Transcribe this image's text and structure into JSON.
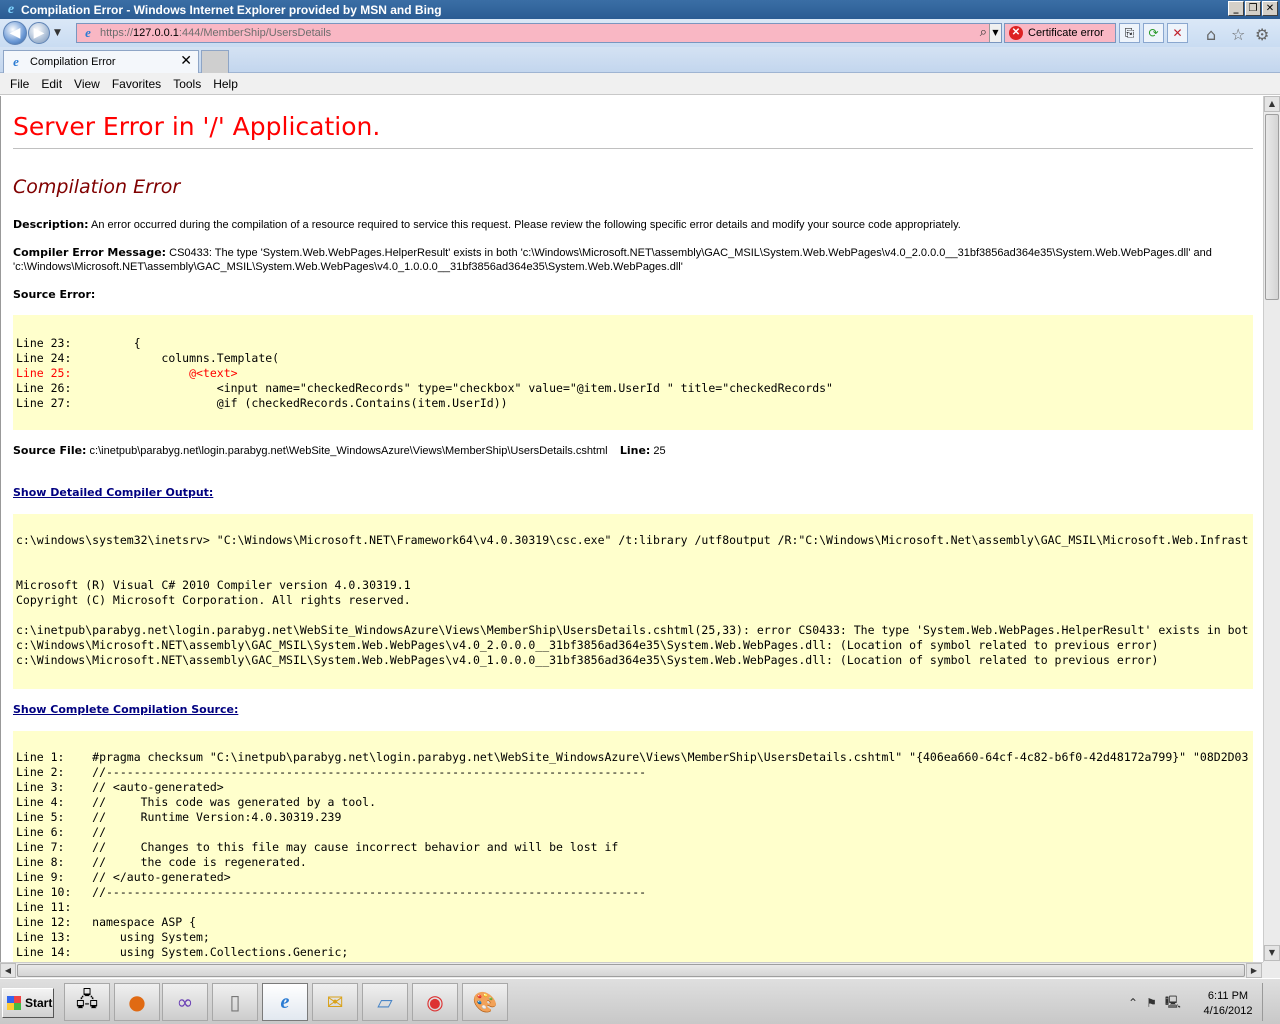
{
  "window": {
    "title": "Compilation Error - Windows Internet Explorer provided by MSN and Bing",
    "minimize": "_",
    "restore": "❐",
    "close": "✕"
  },
  "addressbar": {
    "url_scheme": "https://",
    "url_host": "127.0.0.1",
    "url_rest": ":444/MemberShip/UsersDetails",
    "certificate_label": "Certificate error"
  },
  "tabs": [
    {
      "label": "Compilation Error"
    }
  ],
  "menu": [
    "File",
    "Edit",
    "View",
    "Favorites",
    "Tools",
    "Help"
  ],
  "page": {
    "heading": "Server Error in '/' Application.",
    "subheading": "Compilation Error",
    "description_label": "Description:",
    "description_text": "An error occurred during the compilation of a resource required to service this request. Please review the following specific error details and modify your source code appropriately.",
    "compiler_msg_label": "Compiler Error Message:",
    "compiler_msg_line1": "CS0433: The type 'System.Web.WebPages.HelperResult' exists in both 'c:\\Windows\\Microsoft.NET\\assembly\\GAC_MSIL\\System.Web.WebPages\\v4.0_2.0.0.0__31bf3856ad364e35\\System.Web.WebPages.dll' and",
    "compiler_msg_line2": "'c:\\Windows\\Microsoft.NET\\assembly\\GAC_MSIL\\System.Web.WebPages\\v4.0_1.0.0.0__31bf3856ad364e35\\System.Web.WebPages.dll'",
    "source_error_label": "Source Error:",
    "source_error_lines": [
      {
        "text": "Line 23:         {",
        "highlight": false
      },
      {
        "text": "Line 24:             columns.Template(",
        "highlight": false
      },
      {
        "text": "Line 25:                 @<text>",
        "highlight": true
      },
      {
        "text": "Line 26:                     <input name=\"checkedRecords\" type=\"checkbox\" value=\"@item.UserId \" title=\"checkedRecords\"",
        "highlight": false
      },
      {
        "text": "Line 27:                     @if (checkedRecords.Contains(item.UserId))",
        "highlight": false
      }
    ],
    "source_file_label": "Source File:",
    "source_file_value": "c:\\inetpub\\parabyg.net\\login.parabyg.net\\WebSite_WindowsAzure\\Views\\MemberShip\\UsersDetails.cshtml",
    "line_label": "Line:",
    "line_value": "25",
    "show_compiler_output_link": "Show Detailed Compiler Output:",
    "compiler_output_lines": [
      "c:\\windows\\system32\\inetsrv> \"C:\\Windows\\Microsoft.NET\\Framework64\\v4.0.30319\\csc.exe\" /t:library /utf8output /R:\"C:\\Windows\\Microsoft.Net\\assembly\\GAC_MSIL\\Microsoft.Web.Infrast",
      "",
      "",
      "Microsoft (R) Visual C# 2010 Compiler version 4.0.30319.1",
      "Copyright (C) Microsoft Corporation. All rights reserved.",
      "",
      "c:\\inetpub\\parabyg.net\\login.parabyg.net\\WebSite_WindowsAzure\\Views\\MemberShip\\UsersDetails.cshtml(25,33): error CS0433: The type 'System.Web.WebPages.HelperResult' exists in bot",
      "c:\\Windows\\Microsoft.NET\\assembly\\GAC_MSIL\\System.Web.WebPages\\v4.0_2.0.0.0__31bf3856ad364e35\\System.Web.WebPages.dll: (Location of symbol related to previous error)",
      "c:\\Windows\\Microsoft.NET\\assembly\\GAC_MSIL\\System.Web.WebPages\\v4.0_1.0.0.0__31bf3856ad364e35\\System.Web.WebPages.dll: (Location of symbol related to previous error)"
    ],
    "show_compilation_source_link": "Show Complete Compilation Source:",
    "compilation_source_lines": [
      "Line 1:    #pragma checksum \"C:\\inetpub\\parabyg.net\\login.parabyg.net\\WebSite_WindowsAzure\\Views\\MemberShip\\UsersDetails.cshtml\" \"{406ea660-64cf-4c82-b6f0-42d48172a799}\" \"08D2D03",
      "Line 2:    //------------------------------------------------------------------------------",
      "Line 3:    // <auto-generated>",
      "Line 4:    //     This code was generated by a tool.",
      "Line 5:    //     Runtime Version:4.0.30319.239",
      "Line 6:    //",
      "Line 7:    //     Changes to this file may cause incorrect behavior and will be lost if",
      "Line 8:    //     the code is regenerated.",
      "Line 9:    // </auto-generated>",
      "Line 10:   //------------------------------------------------------------------------------",
      "Line 11:",
      "Line 12:   namespace ASP {",
      "Line 13:       using System;",
      "Line 14:       using System.Collections.Generic;"
    ]
  },
  "taskbar": {
    "start_label": "Start",
    "clock_time": "6:11 PM",
    "clock_date": "4/16/2012"
  },
  "colors": {
    "error_heading": "#ff0000",
    "subheading": "#800000",
    "code_background": "#ffffcc",
    "address_bar_error": "#f9b7c4"
  }
}
